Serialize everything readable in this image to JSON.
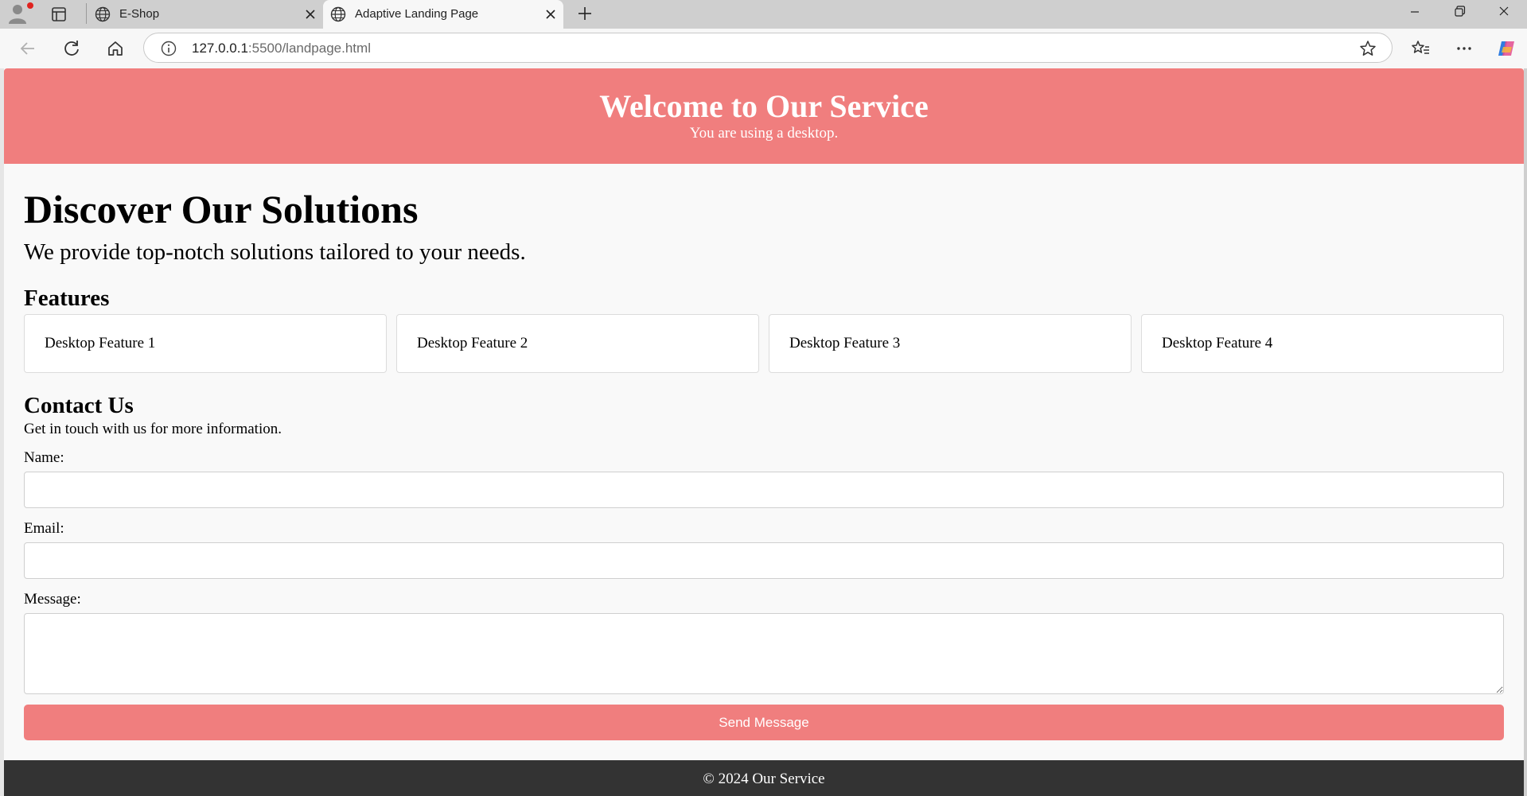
{
  "browser": {
    "tabs": [
      {
        "title": "E-Shop",
        "active": false
      },
      {
        "title": "Adaptive Landing Page",
        "active": true
      }
    ],
    "url_host": "127.0.0.1",
    "url_rest": ":5500/landpage.html",
    "icons": [
      "profile-icon",
      "tab-actions-icon",
      "globe-icon",
      "close-icon",
      "plus-icon",
      "minimize-icon",
      "restore-icon",
      "window-close-icon",
      "back-icon",
      "reload-icon",
      "home-icon",
      "info-icon",
      "star-icon",
      "favorites-icon",
      "more-icon",
      "copilot-icon"
    ]
  },
  "header": {
    "title": "Welcome to Our Service",
    "subtitle": "You are using a desktop."
  },
  "hero": {
    "title": "Discover Our Solutions",
    "text": "We provide top-notch solutions tailored to your needs."
  },
  "features": {
    "title": "Features",
    "items": [
      "Desktop Feature 1",
      "Desktop Feature 2",
      "Desktop Feature 3",
      "Desktop Feature 4"
    ]
  },
  "contact": {
    "title": "Contact Us",
    "text": "Get in touch with us for more information.",
    "name_label": "Name:",
    "email_label": "Email:",
    "message_label": "Message:",
    "name_value": "",
    "email_value": "",
    "message_value": "",
    "submit_label": "Send Message"
  },
  "footer": {
    "text": "© 2024 Our Service"
  },
  "colors": {
    "accent": "#f07e7e",
    "footer_bg": "#333333",
    "page_bg": "#f9f9f9"
  }
}
